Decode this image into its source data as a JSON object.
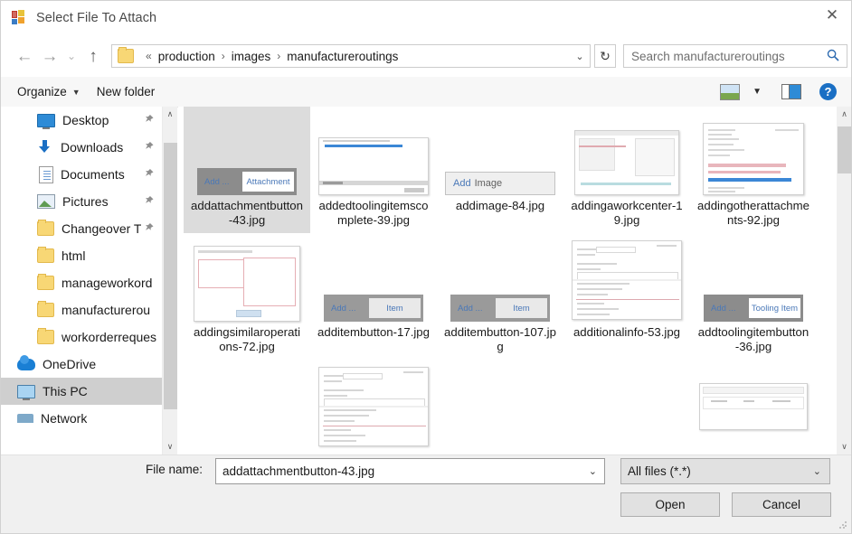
{
  "window": {
    "title": "Select File To Attach",
    "app_icon": "visual-studio-icon",
    "close_label": "✕"
  },
  "nav": {
    "back_icon": "←",
    "forward_icon": "→",
    "history_icon": "⌄",
    "up_icon": "↑",
    "folder_icon": "folder-icon",
    "overflow": "«",
    "breadcrumbs": [
      "production",
      "images",
      "manufactureroutings"
    ],
    "separator": "›",
    "dropdown_icon": "⌄",
    "refresh_icon": "↻"
  },
  "search": {
    "placeholder": "Search manufactureroutings",
    "icon": "search-icon"
  },
  "commandbar": {
    "organize_label": "Organize",
    "organize_caret": "▼",
    "new_folder_label": "New folder",
    "view_icon": "picture-view-icon",
    "view_caret": "▼",
    "preview_pane_icon": "preview-pane-icon",
    "help_icon": "?"
  },
  "sidebar": {
    "items": [
      {
        "label": "Desktop",
        "icon": "desktop-icon",
        "pinned": true,
        "indent": true,
        "selected": false
      },
      {
        "label": "Downloads",
        "icon": "download-icon",
        "pinned": true,
        "indent": true,
        "selected": false
      },
      {
        "label": "Documents",
        "icon": "documents-icon",
        "pinned": true,
        "indent": true,
        "selected": false
      },
      {
        "label": "Pictures",
        "icon": "pictures-icon",
        "pinned": true,
        "indent": true,
        "selected": false
      },
      {
        "label": "Changeover T",
        "icon": "folder-icon",
        "pinned": true,
        "indent": true,
        "selected": false
      },
      {
        "label": "html",
        "icon": "folder-icon",
        "pinned": false,
        "indent": true,
        "selected": false
      },
      {
        "label": "manageworkord",
        "icon": "folder-icon",
        "pinned": false,
        "indent": true,
        "selected": false
      },
      {
        "label": "manufacturerou",
        "icon": "folder-icon",
        "pinned": false,
        "indent": true,
        "selected": false
      },
      {
        "label": "workorderreques",
        "icon": "folder-icon",
        "pinned": false,
        "indent": true,
        "selected": false
      },
      {
        "label": "OneDrive",
        "icon": "onedrive-icon",
        "pinned": false,
        "indent": false,
        "selected": false
      },
      {
        "label": "This PC",
        "icon": "this-pc-icon",
        "pinned": false,
        "indent": false,
        "selected": true
      },
      {
        "label": "Network",
        "icon": "network-icon",
        "pinned": false,
        "indent": false,
        "selected": false
      }
    ],
    "scroll_up_icon": "∧",
    "scroll_down_icon": "∨"
  },
  "files": {
    "scroll_up_icon": "∧",
    "scroll_down_icon": "∨",
    "rows": [
      [
        {
          "name": "addattachmentbutton-43.jpg",
          "thumb": "add-attachment-button",
          "selected": true,
          "thumb_text": {
            "left": "Add ...",
            "right": "Attachment"
          }
        },
        {
          "name": "addedtoolingitemscomplete-39.jpg",
          "thumb": "window-list",
          "selected": false
        },
        {
          "name": "addimage-84.jpg",
          "thumb": "plain-button",
          "selected": false,
          "thumb_text": {
            "left": "Add",
            "right": "Image"
          }
        },
        {
          "name": "addingaworkcenter-19.jpg",
          "thumb": "window-form-teal",
          "selected": false
        },
        {
          "name": "addingotherattachments-92.jpg",
          "thumb": "window-rows-blue",
          "selected": false
        }
      ],
      [
        {
          "name": "addingsimilaroperations-72.jpg",
          "thumb": "window-two-panel",
          "selected": false
        },
        {
          "name": "additembutton-17.jpg",
          "thumb": "add-item-button",
          "selected": false,
          "thumb_text": {
            "left": "Add ...",
            "right": "Item"
          }
        },
        {
          "name": "additembutton-107.jpg",
          "thumb": "add-item-button",
          "selected": false,
          "thumb_text": {
            "left": "Add ...",
            "right": "Item"
          }
        },
        {
          "name": "additionalinfo-53.jpg",
          "thumb": "window-long-form",
          "selected": false
        },
        {
          "name": "addtoolingitembutton-36.jpg",
          "thumb": "add-tooling-button",
          "selected": false,
          "thumb_text": {
            "left": "Add ...",
            "right": "Tooling Item"
          }
        }
      ],
      [
        {
          "name": "",
          "thumb": "empty",
          "selected": false
        },
        {
          "name": "",
          "thumb": "window-long-form",
          "selected": false
        },
        {
          "name": "",
          "thumb": "empty",
          "selected": false
        },
        {
          "name": "",
          "thumb": "empty",
          "selected": false
        },
        {
          "name": "",
          "thumb": "window-table",
          "selected": false
        }
      ]
    ]
  },
  "bottom": {
    "file_name_label": "File name:",
    "file_name_value": "addattachmentbutton-43.jpg",
    "file_name_dropdown_icon": "⌄",
    "file_type_value": "All files (*.*)",
    "file_type_dropdown_icon": "⌄",
    "open_label": "Open",
    "cancel_label": "Cancel"
  }
}
